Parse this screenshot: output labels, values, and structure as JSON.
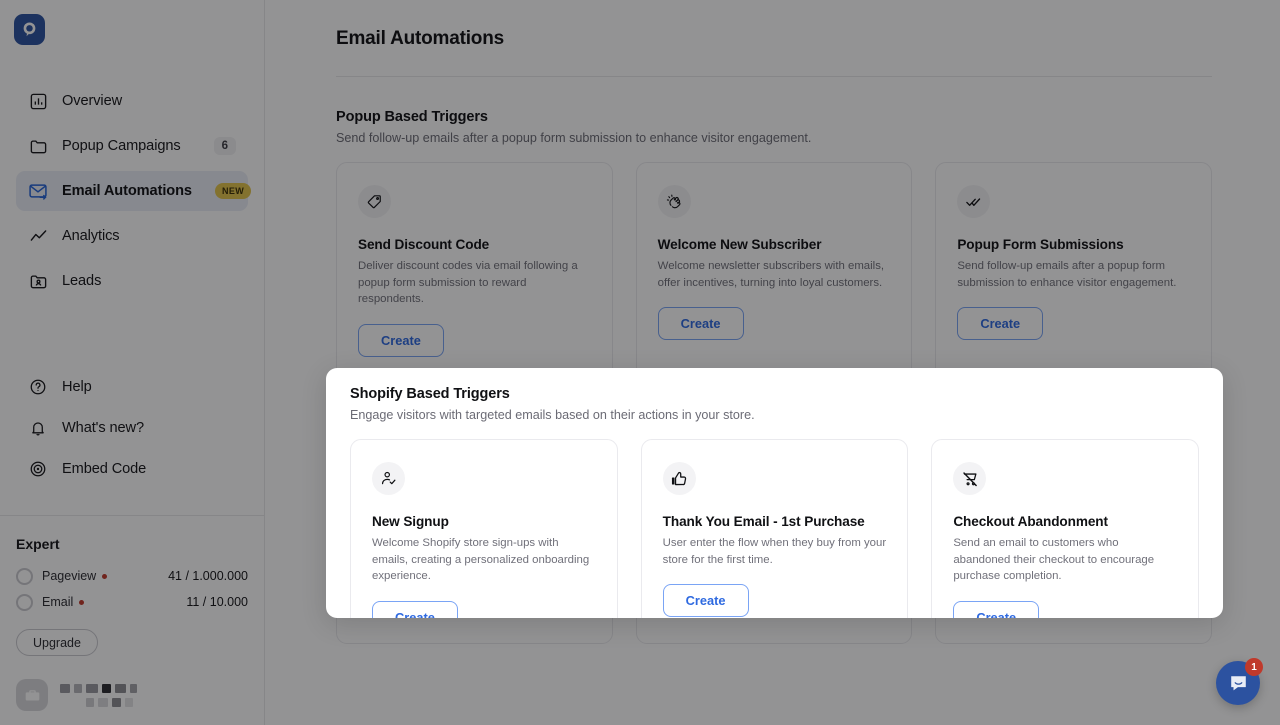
{
  "app": {
    "logo_icon": "popupsmart-logo-icon",
    "accent_blue": "#2c52a0",
    "create_blue": "#2f6ae0",
    "badge_gold": "#e3c54b"
  },
  "sidebar": {
    "primary_items": [
      {
        "icon": "chart-bar-icon",
        "label": "Overview",
        "count": null,
        "badge": null,
        "active": false
      },
      {
        "icon": "folder-icon",
        "label": "Popup Campaigns",
        "count": "6",
        "badge": null,
        "active": false
      },
      {
        "icon": "mail-forward-icon",
        "label": "Email Automations",
        "count": null,
        "badge": "NEW",
        "active": true
      },
      {
        "icon": "trend-line-icon",
        "label": "Analytics",
        "count": null,
        "badge": null,
        "active": false
      },
      {
        "icon": "folder-user-icon",
        "label": "Leads",
        "count": null,
        "badge": null,
        "active": false
      }
    ],
    "secondary_items": [
      {
        "icon": "question-circle-icon",
        "label": "Help"
      },
      {
        "icon": "bell-icon",
        "label": "What's new?"
      },
      {
        "icon": "broadcast-icon",
        "label": "Embed Code"
      }
    ],
    "plan": {
      "name": "Expert",
      "meters": [
        {
          "label": "Pageview",
          "value": "41 / 1.000.000",
          "dot_color": "#c0392b"
        },
        {
          "label": "Email",
          "value": "11 / 10.000",
          "dot_color": "#c0392b"
        }
      ],
      "upgrade_label": "Upgrade"
    },
    "account": {
      "avatar_icon": "briefcase-icon",
      "name_redacted": true
    }
  },
  "header": {
    "title": "Email Automations"
  },
  "sections": [
    {
      "id": "popup-based-triggers",
      "title": "Popup Based Triggers",
      "subtitle": "Send follow-up emails after a popup form submission to enhance visitor engagement.",
      "highlighted": false,
      "cards": [
        {
          "icon": "price-tag-icon",
          "title": "Send Discount Code",
          "description": "Deliver discount codes via email following a popup form submission to reward respondents.",
          "button": "Create"
        },
        {
          "icon": "clapping-hands-icon",
          "title": "Welcome New Subscriber",
          "description": "Welcome newsletter subscribers with emails, offer incentives, turning into loyal customers.",
          "button": "Create"
        },
        {
          "icon": "double-check-icon",
          "title": "Popup Form Submissions",
          "description": "Send follow-up emails after a popup form submission to enhance visitor engagement.",
          "button": "Create"
        }
      ]
    },
    {
      "id": "shopify-based-triggers",
      "title": "Shopify Based Triggers",
      "subtitle": "Engage visitors with targeted emails based on their actions in your store.",
      "highlighted": true,
      "cards": [
        {
          "icon": "user-check-icon",
          "title": "New Signup",
          "description": "Welcome Shopify store sign-ups with emails, creating a personalized onboarding experience.",
          "button": "Create"
        },
        {
          "icon": "thumbs-up-icon",
          "title": "Thank You Email - 1st Purchase",
          "description": "User enter the flow when they buy from your store for the first time.",
          "button": "Create"
        },
        {
          "icon": "cart-off-icon",
          "title": "Checkout Abandonment",
          "description": "Send an email to customers who abandoned their checkout to encourage purchase completion.",
          "button": "Create"
        }
      ]
    }
  ],
  "chat": {
    "icon": "chat-bubble-icon",
    "unread": "1"
  }
}
